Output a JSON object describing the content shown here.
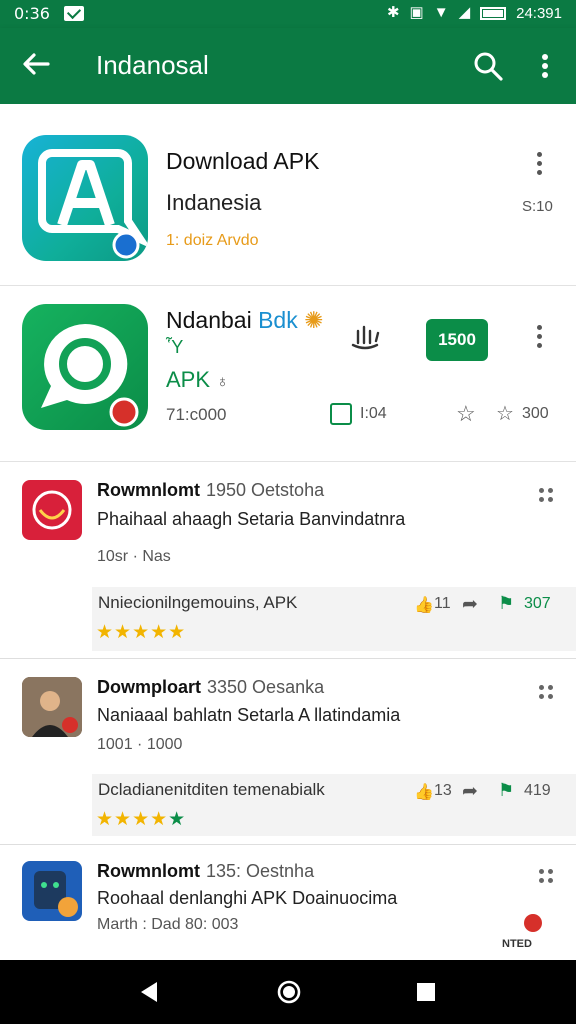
{
  "status_bar": {
    "time": "0:36",
    "clock_right": "24:391"
  },
  "app_bar": {
    "title": "Indanosal"
  },
  "featured": [
    {
      "title": "Download APK",
      "subtitle": "Indanesia",
      "developer": "1: doiz Arvdo",
      "side_label": "S:10"
    },
    {
      "title": "Ndanbai",
      "title_accent": "Bdk",
      "line2": "Ὗ",
      "line3": "APK",
      "downloads": "71:c000",
      "badge": "1500",
      "stat1": "I:04",
      "stat2": "300"
    }
  ],
  "list": [
    {
      "title": "Rowmnlomt",
      "meta": "1950 Oetstoha",
      "desc": "Phaihaal ahaagh Setaria Banvindatnra",
      "meta2": "10sr · Nas",
      "review": "Nniecionilngemouins, APK",
      "likes": "11",
      "score": "307",
      "rating": 5
    },
    {
      "title": "Dowmploart",
      "meta": "3350 Oesanka",
      "desc": "Naniaaal bahlatn Setarla A llatindamia",
      "meta2": "1001 · 1000",
      "review": "Dcladianenitditen temenabialk",
      "likes": "13",
      "score": "419",
      "rating": 5
    },
    {
      "title": "Rowmnlomt",
      "meta": "135: Oestnha",
      "desc": "Roohaal denlanghi APK Doainuocima",
      "meta2": "Marth : Dad 80: 003",
      "badge": "NTED"
    }
  ],
  "colors": {
    "brand": "#0b7a43",
    "star": "#f2b400",
    "accent_green": "#0b8d48",
    "accent_orange": "#e79b1a"
  }
}
